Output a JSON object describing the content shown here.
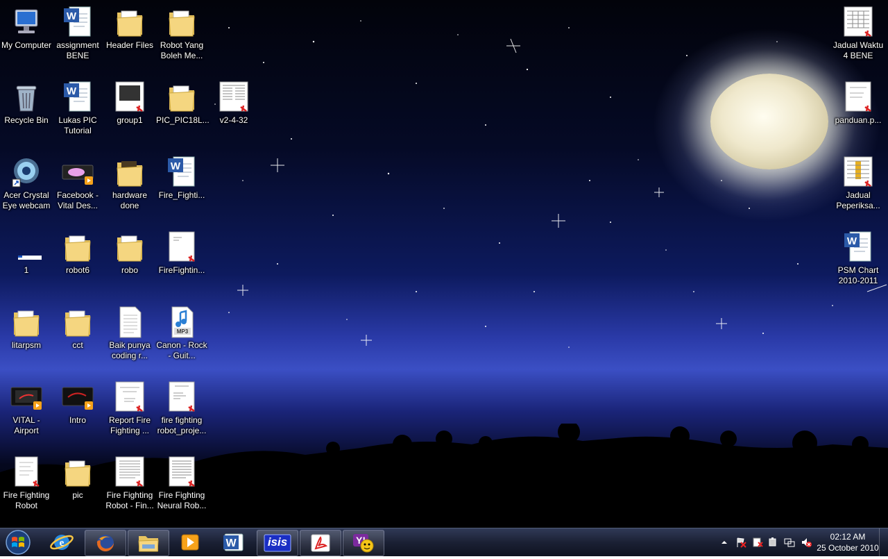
{
  "desktop": {
    "icons": [
      {
        "id": "my-computer",
        "label": "My Computer"
      },
      {
        "id": "assignment-bene",
        "label": "assignment BENE"
      },
      {
        "id": "header-files",
        "label": "Header Files"
      },
      {
        "id": "robot-yang",
        "label": "Robot Yang Boleh Me..."
      },
      {
        "id": "recycle-bin",
        "label": "Recycle Bin"
      },
      {
        "id": "lukas-pic",
        "label": "Lukas PIC Tutorial"
      },
      {
        "id": "group1",
        "label": "group1"
      },
      {
        "id": "pic-pic18l",
        "label": "PIC_PIC18L..."
      },
      {
        "id": "v2-4-32",
        "label": "v2-4-32"
      },
      {
        "id": "acer-crystal",
        "label": "Acer Crystal Eye webcam"
      },
      {
        "id": "facebook-vital",
        "label": "Facebook - Vital Des..."
      },
      {
        "id": "hardware-done",
        "label": "hardware done"
      },
      {
        "id": "fire-fighti-doc",
        "label": "Fire_Fighti..."
      },
      {
        "id": "one",
        "label": "1"
      },
      {
        "id": "robot6",
        "label": "robot6"
      },
      {
        "id": "robo",
        "label": "robo"
      },
      {
        "id": "firefightin-pdf",
        "label": "FireFightin..."
      },
      {
        "id": "litarpsm",
        "label": "litarpsm"
      },
      {
        "id": "cct",
        "label": "cct"
      },
      {
        "id": "baik-punya",
        "label": "Baik punya coding r..."
      },
      {
        "id": "canon-rock",
        "label": "Canon - Rock - Guit..."
      },
      {
        "id": "vital-airport",
        "label": "VITAL - Airport"
      },
      {
        "id": "intro",
        "label": "Intro"
      },
      {
        "id": "report-fire",
        "label": "Report Fire Fighting ..."
      },
      {
        "id": "fire-fighting-robot-proje",
        "label": "fire fighting robot_proje..."
      },
      {
        "id": "fire-fighting-robot",
        "label": "Fire Fighting Robot"
      },
      {
        "id": "pic",
        "label": "pic"
      },
      {
        "id": "fire-fighting-robot-fin",
        "label": "Fire Fighting Robot - Fin..."
      },
      {
        "id": "fire-fighting-neural",
        "label": "Fire Fighting Neural Rob..."
      },
      {
        "id": "jadual-waktu",
        "label": "Jadual Waktu 4 BENE"
      },
      {
        "id": "panduan",
        "label": "panduan.p..."
      },
      {
        "id": "jadual-peperiksa",
        "label": "Jadual Peperiksa..."
      },
      {
        "id": "psm-chart",
        "label": "PSM Chart 2010-2011"
      }
    ]
  },
  "taskbar": {
    "clock_time": "02:12 AM",
    "clock_date": "25 October 2010",
    "isis_label": "isis"
  }
}
